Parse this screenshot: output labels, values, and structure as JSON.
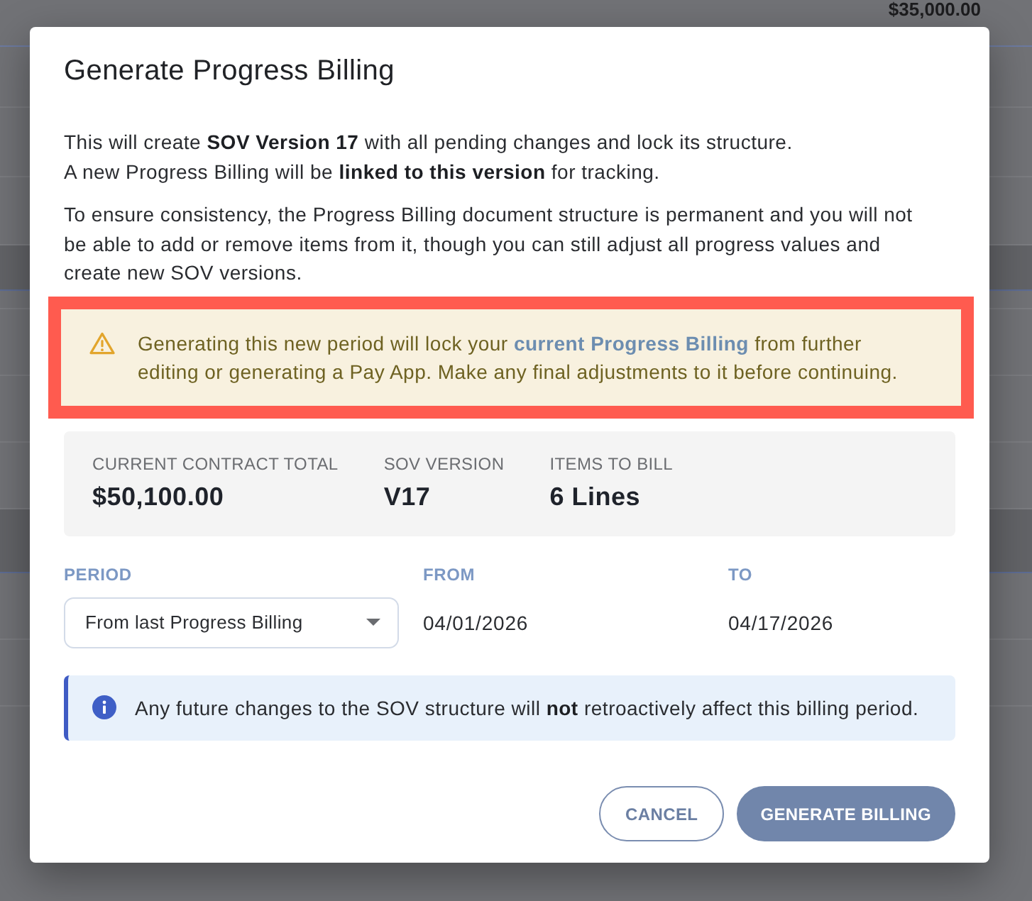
{
  "background": {
    "amount": "$35,000.00"
  },
  "dialog": {
    "title": "Generate Progress Billing",
    "paragraphs": [
      {
        "lines": [
          "This will create **SOV Version 17** with all pending changes and lock its structure.",
          "A new Progress Billing will be **linked to this version** for tracking."
        ]
      },
      {
        "lines": [
          "To ensure consistency, the Progress Billing document structure is permanent and you will not",
          "be able to add or remove items from it, though you can still adjust all progress values and",
          "create new SOV versions."
        ]
      }
    ],
    "warning": {
      "highlighted": true,
      "text_before": "Generating this new period will lock your",
      "link": "current Progress Billing",
      "text_after": "from further editing or generating a Pay App. Make any final adjustments to it before continuing."
    },
    "summary": [
      {
        "label": "CURRENT CONTRACT TOTAL",
        "value": "$50,100.00"
      },
      {
        "label": "SOV VERSION",
        "value": "V17"
      },
      {
        "label": "ITEMS TO BILL",
        "value": "6 Lines"
      }
    ],
    "period_fields": [
      {
        "kind": "select",
        "label": "PERIOD",
        "value": "From last Progress Billing"
      },
      {
        "kind": "text",
        "label": "FROM",
        "value": "04/01/2026"
      },
      {
        "kind": "text",
        "label": "TO",
        "value": "04/17/2026"
      }
    ],
    "info": {
      "text": "Any future changes to the SOV structure will **not** retroactively affect this billing period."
    },
    "buttons": [
      {
        "kind": "outline",
        "label": "CANCEL"
      },
      {
        "kind": "primary",
        "label": "GENERATE BILLING"
      }
    ]
  }
}
